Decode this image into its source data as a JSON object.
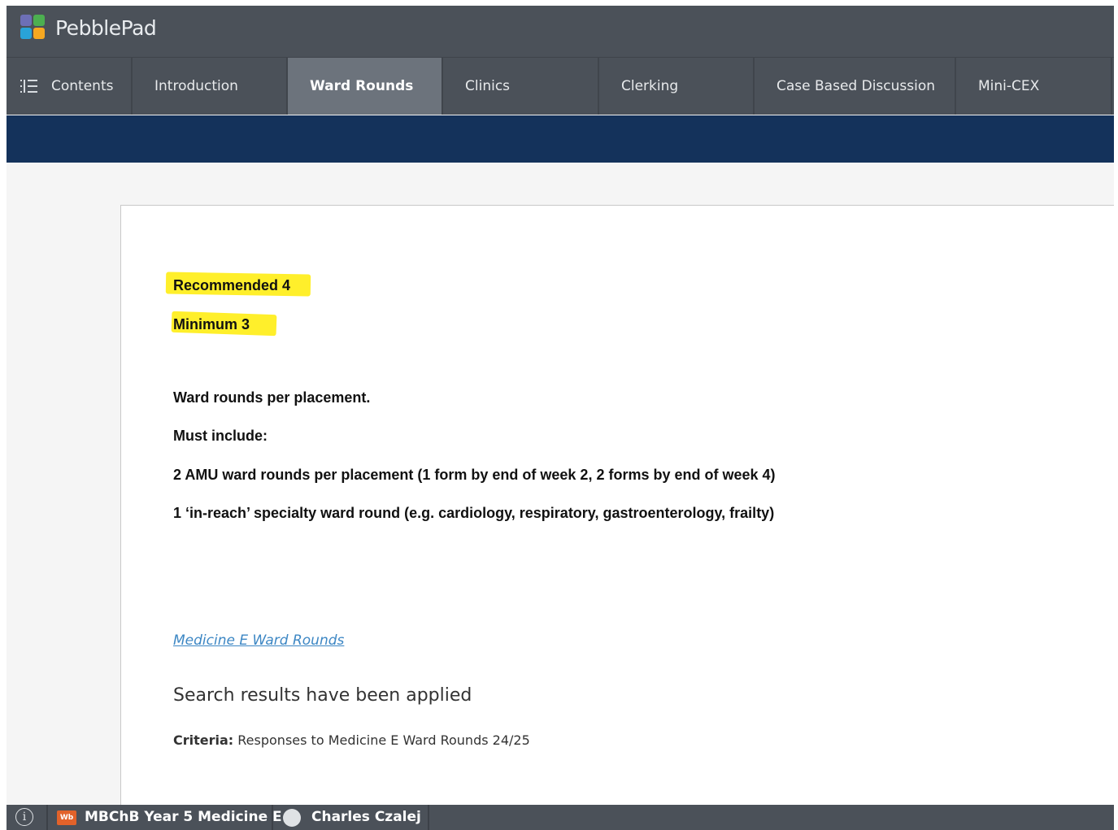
{
  "app": {
    "brand": "PebblePad",
    "logo_colors": [
      "#6d6fb6",
      "#4caf50",
      "#29a3d8",
      "#f6a821"
    ]
  },
  "nav": {
    "contents_label": "Contents",
    "tabs": [
      {
        "label": "Introduction"
      },
      {
        "label": "Ward Rounds",
        "active": true
      },
      {
        "label": "Clinics"
      },
      {
        "label": "Clerking"
      },
      {
        "label": "Case Based Discussion"
      },
      {
        "label": "Mini-CEX"
      }
    ]
  },
  "content": {
    "recommended": "Recommended 4",
    "minimum": "Minimum 3",
    "per_placement": "Ward rounds per placement.",
    "must_include": "Must include:",
    "amu": "2 AMU ward rounds per placement (1 form by end of week 2, 2 forms by end of week 4)",
    "in_reach": "1 ‘in-reach’ specialty ward round (e.g. cardiology, respiratory, gastroenterology, frailty)",
    "highlight_color": "#ffef2b",
    "link_text": "Medicine E Ward Rounds",
    "search_title": "Search results have been applied",
    "criteria_label": "Criteria:",
    "criteria_value": "Responses to Medicine E Ward Rounds 24/25"
  },
  "footer": {
    "badge": "Wb",
    "workbook": "MBChB Year 5 Medicine E",
    "user": "Charles Czalej"
  }
}
